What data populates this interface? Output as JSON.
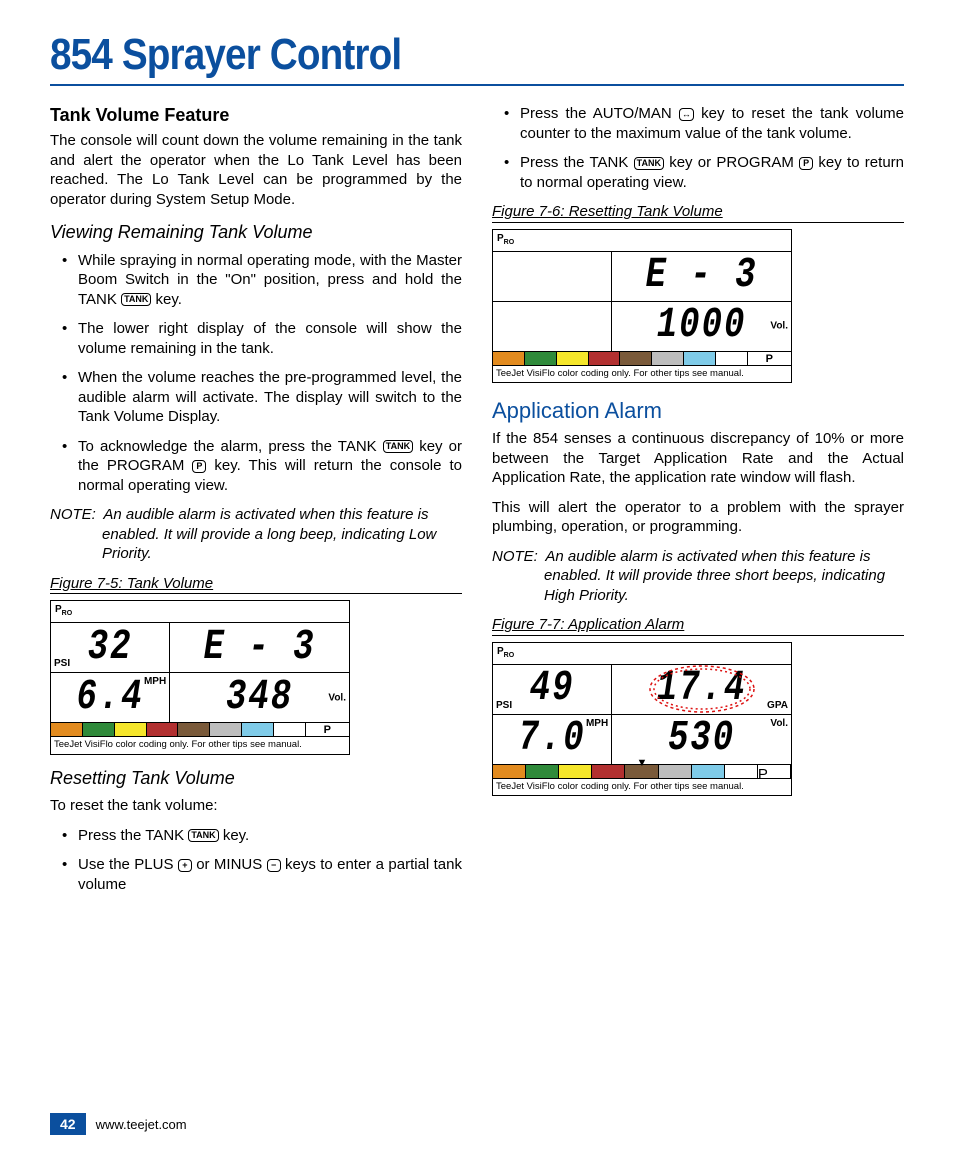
{
  "page": {
    "title": "854 Sprayer Control",
    "number": "42",
    "url": "www.teejet.com"
  },
  "left": {
    "h1": "Tank Volume Feature",
    "p1": "The console will count down the volume remaining in the tank and alert the operator when the Lo Tank Level has been reached. The Lo Tank Level can be programmed by the operator during System Setup Mode.",
    "h2": "Viewing Remaining Tank Volume",
    "b1": "While spraying in normal operating mode, with the Master Boom Switch in the \"On\" position, press and hold the TANK ",
    "b1b": " key.",
    "b2": "The lower right display of the console will show the volume remaining in the tank.",
    "b3": "When the volume reaches the pre-programmed level, the audible alarm will activate. The display will switch to the Tank Volume Display.",
    "b4a": "To acknowledge the alarm, press the TANK ",
    "b4b": " key or the PROGRAM ",
    "b4c": " key. This will return the console to normal operating view.",
    "note1a": "NOTE: ",
    "note1b": "An audible alarm is activated when this feature is enabled. It will provide a long beep, indicating Low Priority.",
    "fig75": "Figure 7-5: Tank Volume",
    "h3": "Resetting Tank Volume",
    "p2": "To reset the tank volume:",
    "b5a": "Press the TANK ",
    "b5b": " key.",
    "b6a": "Use the PLUS ",
    "b6b": " or MINUS ",
    "b6c": " keys to enter a partial tank volume"
  },
  "right": {
    "b1a": "Press the AUTO/MAN ",
    "b1b": " key to reset the tank volume counter to the maximum value of the tank volume.",
    "b2a": "Press the TANK ",
    "b2b": " key or PROGRAM ",
    "b2c": " key to return to normal operating view.",
    "fig76": "Figure 7-6: Resetting Tank Volume",
    "h1": "Application Alarm",
    "p1": "If the 854 senses a continuous discrepancy of 10% or more between the Target Application Rate and the Actual Application Rate, the application rate window will flash.",
    "p2": "This will alert the operator to a problem with the sprayer plumbing, operation, or programming.",
    "note1a": "NOTE: ",
    "note1b": "An audible alarm is activated when this feature is enabled. It will provide three short beeps, indicating High Priority.",
    "fig77": "Figure 7-7: Application Alarm"
  },
  "keys": {
    "tank": "TANK",
    "program": "P",
    "plus": "+",
    "minus": "−",
    "automan": "↔"
  },
  "lcd": {
    "pro": "P",
    "prosub": "RO",
    "psi": "PSI",
    "mph": "MPH",
    "vol": "Vol.",
    "gpa": "GPA",
    "p": "P",
    "foot": "TeeJet VisiFlo color coding only. For other tips see manual.",
    "fig75": {
      "tl": "32",
      "tr": "E - 3",
      "bl": "6.4",
      "br": "348"
    },
    "fig76": {
      "tr": "E - 3",
      "br": "1000"
    },
    "fig77": {
      "tl": "49",
      "tr": "17.4",
      "bl": "7.0",
      "br": "530"
    },
    "colors": [
      "#e28b1f",
      "#2f8a3a",
      "#f5e62b",
      "#b23030",
      "#7a5a3a",
      "#bdbdbd",
      "#7fcbe8",
      "#ffffff",
      "#ffffff"
    ]
  }
}
